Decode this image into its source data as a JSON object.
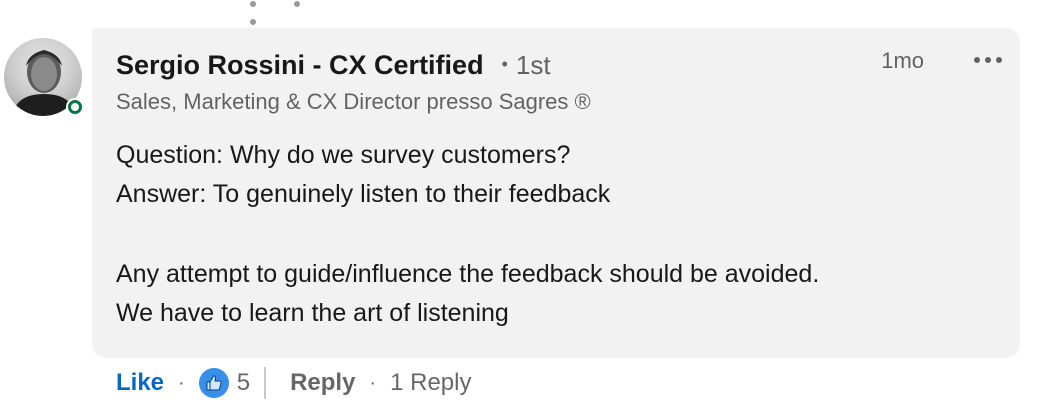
{
  "author": {
    "name": "Sergio Rossini - CX Certified",
    "degree": "1st",
    "headline": "Sales, Marketing & CX Director presso Sagres ®",
    "online": true
  },
  "comment": {
    "time": "1mo",
    "lines": [
      "Question: Why do we survey customers?",
      "Answer: To genuinely listen to their feedback",
      "",
      "Any attempt to guide/influence the feedback should be avoided.",
      "We have to learn the art of listening"
    ]
  },
  "actions": {
    "like_label": "Like",
    "reaction_count": "5",
    "reply_label": "Reply",
    "replies_label": "1 Reply"
  },
  "colors": {
    "accent": "#0a66c2",
    "bubble": "#f2f2f2",
    "online": "#057642",
    "reaction": "#378fe9"
  },
  "icons": [
    "online-status-icon",
    "more-options-icon",
    "like-reaction-icon"
  ]
}
